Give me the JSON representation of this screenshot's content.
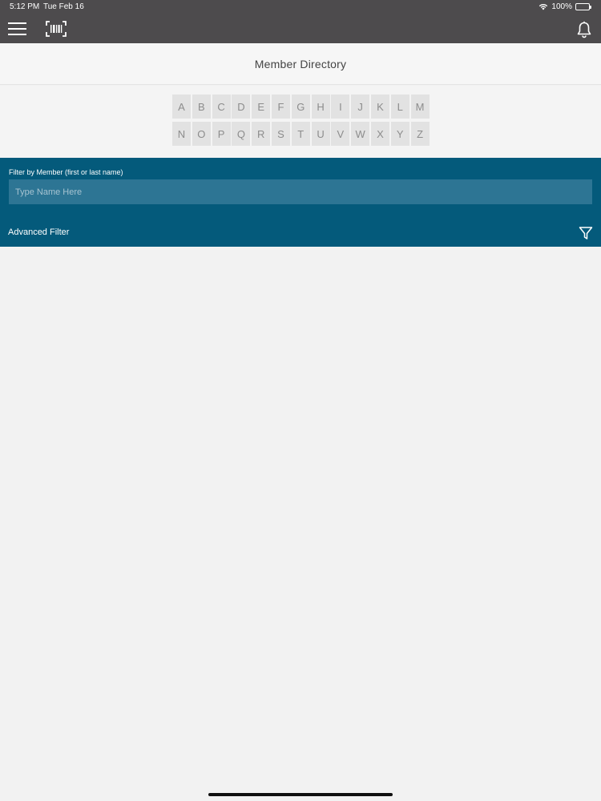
{
  "status_bar": {
    "time": "5:12 PM",
    "date": "Tue Feb 16",
    "battery": "100%",
    "icons": [
      "wifi-icon",
      "battery-icon"
    ]
  },
  "nav": {
    "icons": [
      "menu-icon",
      "barcode-scan-icon",
      "bell-icon"
    ]
  },
  "page": {
    "title": "Member Directory"
  },
  "alphabet": {
    "row1": [
      "A",
      "B",
      "C",
      "D",
      "E",
      "F",
      "G",
      "H",
      "I",
      "J",
      "K",
      "L",
      "M"
    ],
    "row2": [
      "N",
      "O",
      "P",
      "Q",
      "R",
      "S",
      "T",
      "U",
      "V",
      "W",
      "X",
      "Y",
      "Z"
    ]
  },
  "filter": {
    "label": "Filter by Member (first or last name)",
    "placeholder": "Type Name Here",
    "value": "",
    "advanced_label": "Advanced Filter",
    "icon": "funnel-icon"
  },
  "colors": {
    "topbar": "#4d4b4d",
    "panel": "#045a7b",
    "input": "#2d7594",
    "background": "#f2f2f2"
  }
}
